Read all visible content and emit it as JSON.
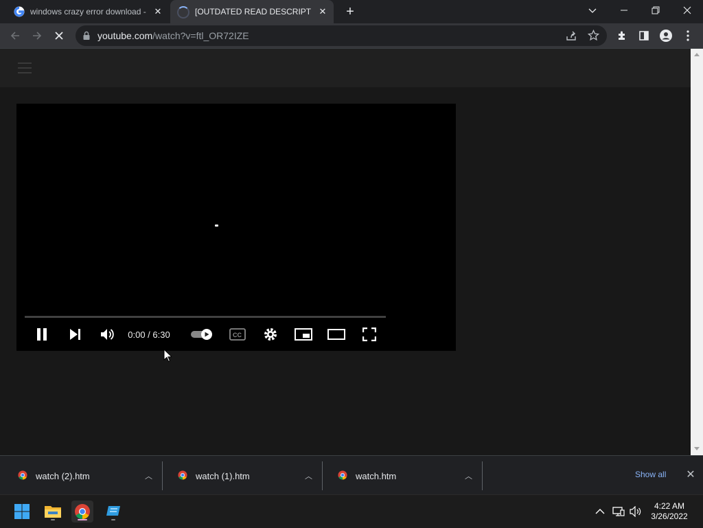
{
  "tabs": [
    {
      "title": "windows crazy error download -",
      "favicon": "google-icon"
    },
    {
      "title": "[OUTDATED READ DESCRIPTION]",
      "favicon": "loading-spinner-icon"
    }
  ],
  "address": {
    "domain": "youtube.com",
    "path": "/watch?v=ftl_OR72IZE"
  },
  "player": {
    "time": "0:00 / 6:30",
    "progress": 0
  },
  "downloads": [
    {
      "name": "watch (2).htm"
    },
    {
      "name": "watch (1).htm"
    },
    {
      "name": "watch.htm"
    }
  ],
  "downloads_show_all": "Show all",
  "clock": {
    "time": "4:22 AM",
    "date": "3/26/2022"
  },
  "colors": {
    "accent_blue": "#8ab4f8",
    "page_bg": "#181818",
    "header_bg": "#202020"
  }
}
